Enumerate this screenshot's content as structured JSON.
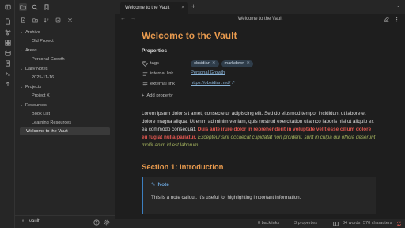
{
  "ribbon": {
    "icons": [
      "sidebar-toggle-icon",
      "open-file-icon",
      "graph-view-icon",
      "canvas-icon",
      "daily-note-icon",
      "template-icon",
      "command-palette-icon",
      "publish-icon"
    ]
  },
  "sidebar": {
    "tabs": [
      "files-icon",
      "search-icon",
      "bookmark-icon"
    ],
    "actions": [
      "new-note-icon",
      "new-folder-icon",
      "sort-icon",
      "collapse-all-icon",
      "close-icon"
    ],
    "tree": [
      {
        "type": "folder",
        "label": "Archive"
      },
      {
        "type": "file",
        "label": "Old Project"
      },
      {
        "type": "folder",
        "label": "Areas"
      },
      {
        "type": "file",
        "label": "Personal Growth"
      },
      {
        "type": "folder",
        "label": "Daily Notes"
      },
      {
        "type": "file",
        "label": "2025-11-16"
      },
      {
        "type": "folder",
        "label": "Projects"
      },
      {
        "type": "file",
        "label": "Project X"
      },
      {
        "type": "folder",
        "label": "Resources"
      },
      {
        "type": "file",
        "label": "Book List"
      },
      {
        "type": "file",
        "label": "Learning Resources"
      },
      {
        "type": "selected",
        "label": "Welcome to the Vault"
      }
    ],
    "vault_name": "vault"
  },
  "tabbar": {
    "tab_title": "Welcome to the Vault",
    "close_glyph": "×",
    "new_tab_glyph": "+",
    "menu_glyph": "⌄"
  },
  "navbar": {
    "back_glyph": "←",
    "forward_glyph": "→",
    "view_title": "Welcome to the Vault"
  },
  "document": {
    "title": "Welcome to the Vault",
    "properties_heading": "Properties",
    "properties": {
      "tags": {
        "key": "tags",
        "values": [
          "obsidian",
          "markdown"
        ]
      },
      "internal": {
        "key": "internal link",
        "value": "Personal Growth"
      },
      "external": {
        "key": "external link",
        "value": "https://obsidian.md/"
      }
    },
    "add_property": "Add property",
    "paragraph": {
      "plain": "Lorem ipsum dolor sit amet, consectetur adipiscing elit. Sed do eiusmod tempor incididunt ut labore et dolore magna aliqua. Ut enim ad minim veniam, quis nostrud exercitation ullamco laboris nisi ut aliquip ex ea commodo consequat. ",
      "bold_red": "Duis aute irure dolor in reprehenderit in voluptate velit esse cillum dolore eu fugiat nulla pariatur.",
      "italic_green": " Excepteur sint occaecat cupidatat non proident, sunt in culpa qui officia deserunt mollit anim id est laborum."
    },
    "section_heading": "Section 1: Introduction",
    "callout": {
      "title": "Note",
      "body": "This is a note callout. It's useful for highlighting important information."
    }
  },
  "statusbar": {
    "backlinks": "0 backlinks",
    "properties": "3 properties",
    "words": "84 words",
    "characters": "570 characters"
  },
  "colors": {
    "accent_heading": "#e89a4e",
    "link": "#8ab4d8",
    "callout_border": "#3c7fc0",
    "highlight_red": "#e0564f",
    "highlight_green": "#a9b860"
  }
}
